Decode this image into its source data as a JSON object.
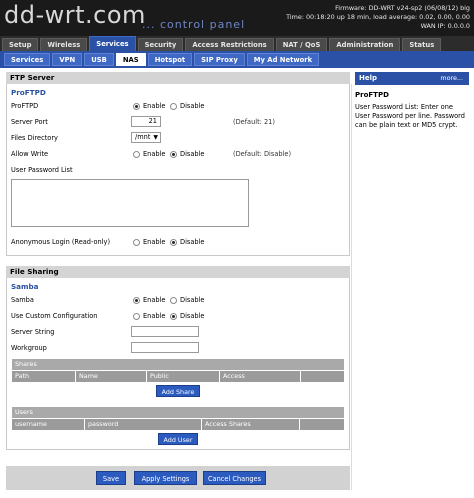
{
  "header": {
    "logo": "dd-wrt.com",
    "logo_sub": "... control panel",
    "firmware": "Firmware: DD-WRT v24-sp2 (06/08/12) big",
    "time": "Time: 00:18:20 up 18 min, load average: 0.02, 0.00, 0.00",
    "wan_ip": "WAN IP: 0.0.0.0"
  },
  "main_tabs": [
    "Setup",
    "Wireless",
    "Services",
    "Security",
    "Access Restrictions",
    "NAT / QoS",
    "Administration",
    "Status"
  ],
  "sub_tabs": [
    "Services",
    "VPN",
    "USB",
    "NAS",
    "Hotspot",
    "SIP Proxy",
    "My Ad Network"
  ],
  "ftp": {
    "section": "FTP Server",
    "legend": "ProFTPD",
    "proftpd_label": "ProFTPD",
    "port_label": "Server Port",
    "port_value": "21",
    "port_default": "(Default: 21)",
    "dir_label": "Files Directory",
    "dir_value": "/mnt",
    "write_label": "Allow Write",
    "write_default": "(Default: Disable)",
    "pw_label": "User Password List",
    "anon_label": "Anonymous Login (Read-only)"
  },
  "radio": {
    "enable": "Enable",
    "disable": "Disable"
  },
  "sharing": {
    "section": "File Sharing",
    "legend": "Samba",
    "samba_label": "Samba",
    "custom_label": "Use Custom Configuration",
    "server_string_label": "Server String",
    "workgroup_label": "Workgroup",
    "shares_header": "Shares",
    "shares_cols": [
      "Path",
      "Name",
      "Public",
      "Access"
    ],
    "add_share": "Add Share",
    "users_header": "Users",
    "users_cols": [
      "username",
      "password",
      "Access Shares"
    ],
    "add_user": "Add User"
  },
  "footer": {
    "save": "Save",
    "apply": "Apply Settings",
    "cancel": "Cancel Changes"
  },
  "help": {
    "title": "Help",
    "more": "more...",
    "section_title": "ProFTPD",
    "text": "User Password List: Enter one User Password per line. Password can be plain text or MD5 crypt."
  },
  "colors": {
    "accent": "#2a51a6",
    "header_bg": "#1a1a1a",
    "section_bg": "#d4d4d4",
    "button": "#2b5bbf"
  }
}
